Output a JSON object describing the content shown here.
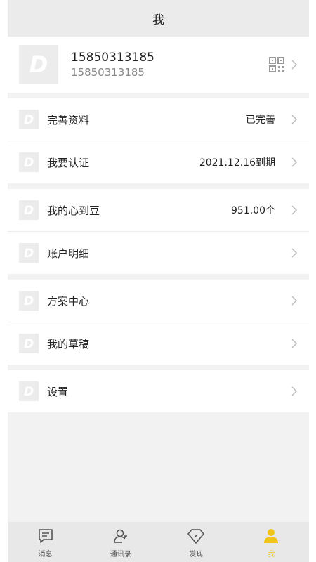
{
  "header": {
    "title": "我"
  },
  "profile": {
    "name": "15850313185",
    "account": "15850313185",
    "avatar_letter": "D"
  },
  "groups": [
    [
      {
        "icon": "d-logo-icon",
        "label": "完善资料",
        "value": "已完善"
      },
      {
        "icon": "d-logo-icon",
        "label": "我要认证",
        "value": "2021.12.16到期"
      }
    ],
    [
      {
        "icon": "d-logo-icon",
        "label": "我的心到豆",
        "value": "951.00个"
      },
      {
        "icon": "d-logo-icon",
        "label": "账户明细",
        "value": ""
      }
    ],
    [
      {
        "icon": "d-logo-icon",
        "label": "方案中心",
        "value": ""
      },
      {
        "icon": "d-logo-icon",
        "label": "我的草稿",
        "value": ""
      }
    ],
    [
      {
        "icon": "d-logo-icon",
        "label": "设置",
        "value": ""
      }
    ]
  ],
  "tabs": [
    {
      "icon": "message-icon",
      "label": "消息"
    },
    {
      "icon": "contacts-icon",
      "label": "通讯录"
    },
    {
      "icon": "discover-icon",
      "label": "发现"
    },
    {
      "icon": "user-icon",
      "label": "我",
      "active": true
    }
  ],
  "colors": {
    "accent": "#f0c419",
    "header_bg": "#ebebeb",
    "page_bg": "#f2f2f2"
  }
}
